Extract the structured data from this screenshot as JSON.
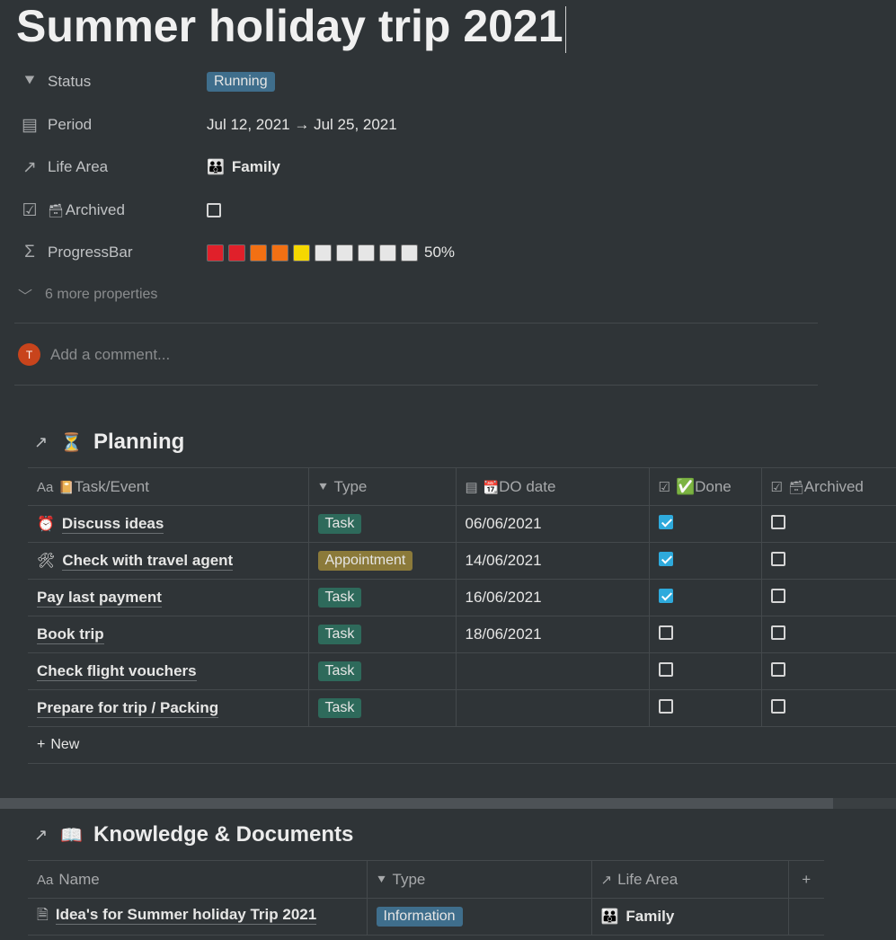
{
  "page": {
    "title": "Summer holiday trip 2021"
  },
  "properties": {
    "status": {
      "label": "Status",
      "value": "Running"
    },
    "period": {
      "label": "Period",
      "value": "Jul 12, 2021 → Jul 25, 2021"
    },
    "life_area": {
      "label": "Life Area",
      "value": "Family",
      "icon": "family-emoji"
    },
    "archived": {
      "label": "Archived",
      "checked": false
    },
    "progress": {
      "label": "ProgressBar",
      "value": "50%",
      "fraction": 0.5,
      "colors": [
        "#e0202a",
        "#e0202a",
        "#f27013",
        "#f27013",
        "#f5d800",
        "#e6e6e6",
        "#e6e6e6",
        "#e6e6e6",
        "#e6e6e6",
        "#e6e6e6"
      ]
    },
    "more": "6 more properties"
  },
  "comment": {
    "avatar_initial": "T",
    "placeholder": "Add a comment..."
  },
  "planning": {
    "title": "Planning",
    "columns": [
      "Task/Event",
      "Type",
      "DO date",
      "Done",
      "Archived"
    ],
    "rows": [
      {
        "name": "Discuss ideas",
        "icon": "alarm-clock-emoji",
        "type": "Task",
        "date": "06/06/2021",
        "done": true,
        "archived": false
      },
      {
        "name": "Check with travel agent",
        "icon": "tools-emoji",
        "type": "Appointment",
        "date": "14/06/2021",
        "done": true,
        "archived": false
      },
      {
        "name": "Pay last payment",
        "type": "Task",
        "date": "16/06/2021",
        "done": true,
        "archived": false
      },
      {
        "name": "Book trip",
        "type": "Task",
        "date": "18/06/2021",
        "done": false,
        "archived": false
      },
      {
        "name": "Check flight vouchers",
        "type": "Task",
        "date": "",
        "done": false,
        "archived": false
      },
      {
        "name": "Prepare for trip / Packing",
        "type": "Task",
        "date": "",
        "done": false,
        "archived": false
      }
    ],
    "new_label": "New"
  },
  "knowledge": {
    "title": "Knowledge & Documents",
    "columns": [
      "Name",
      "Type",
      "Life Area"
    ],
    "rows": [
      {
        "name": "Idea's for Summer holiday Trip 2021",
        "type": "Information",
        "life_area": "Family"
      }
    ]
  }
}
